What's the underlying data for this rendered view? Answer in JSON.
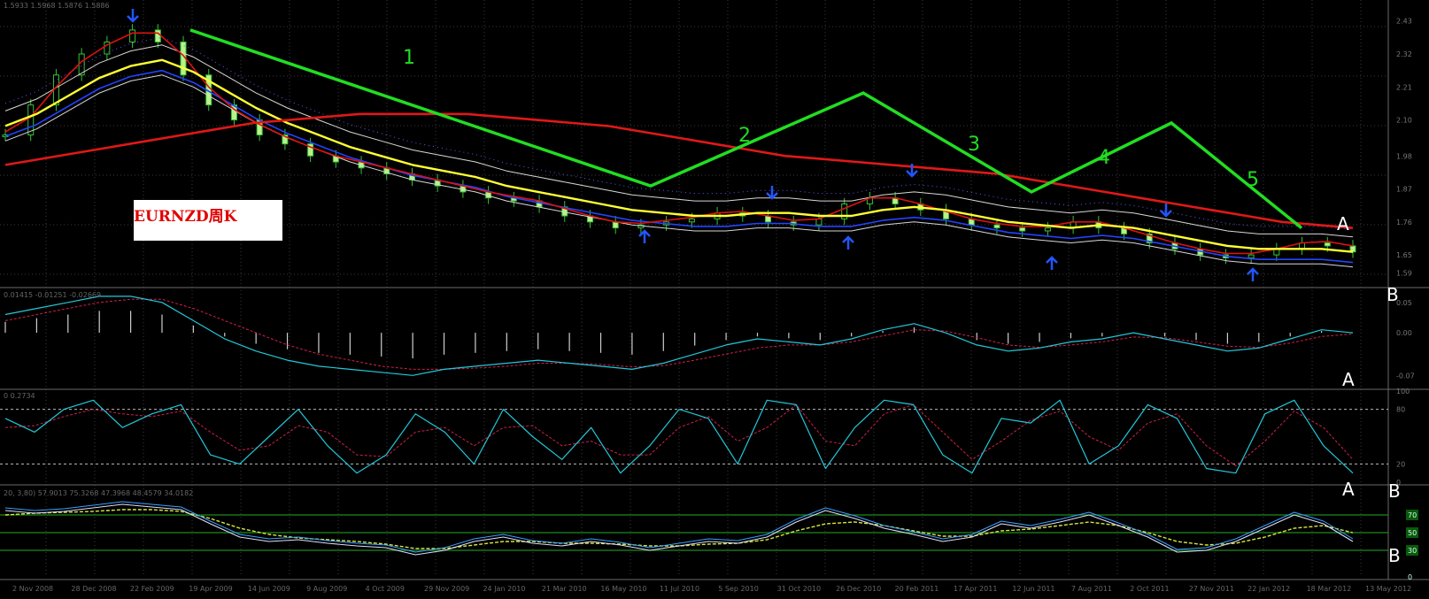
{
  "chart_data": [
    {
      "type": "line",
      "panel": "price",
      "title": "EURNZD周K",
      "header": "1.5933 1.5968 1.5876 1.5886",
      "wave_labels": [
        "1",
        "2",
        "3",
        "4",
        "5"
      ],
      "marks": [
        "A",
        "B"
      ],
      "wave_path": {
        "x": [
          "14 Jan 2009",
          "9 Aug 2010",
          "9 Feb 2011",
          "9 Aug 2011",
          "9 Feb 2012",
          "9 Aug 2012"
        ],
        "y": [
          2.4,
          1.88,
          2.19,
          1.86,
          2.09,
          1.74
        ]
      },
      "x_ticks": [
        "2 Nov 2008",
        "28 Dec 2008",
        "22 Feb 2009",
        "19 Apr 2009",
        "14 Jun 2009",
        "9 Aug 2009",
        "4 Oct 2009",
        "29 Nov 2009",
        "24 Jan 2010",
        "21 Mar 2010",
        "16 May 2010",
        "11 Jul 2010",
        "5 Sep 2010",
        "31 Oct 2010",
        "26 Dec 2010",
        "20 Feb 2011",
        "17 Apr 2011",
        "12 Jun 2011",
        "7 Aug 2011",
        "2 Oct 2011",
        "27 Nov 2011",
        "22 Jan 2012",
        "18 Mar 2012",
        "13 May 2012"
      ],
      "y_ticks": [
        2.43,
        2.32,
        2.21,
        2.1,
        1.98,
        1.87,
        1.76,
        1.65,
        1.59
      ],
      "ylim": [
        1.55,
        2.5
      ],
      "series": [
        {
          "name": "price",
          "values": [
            2.05,
            2.15,
            2.25,
            2.32,
            2.36,
            2.4,
            2.36,
            2.25,
            2.15,
            2.1,
            2.05,
            2.02,
            1.98,
            1.96,
            1.94,
            1.92,
            1.9,
            1.88,
            1.86,
            1.84,
            1.83,
            1.81,
            1.78,
            1.76,
            1.74,
            1.75,
            1.76,
            1.77,
            1.79,
            1.78,
            1.76,
            1.75,
            1.77,
            1.82,
            1.84,
            1.82,
            1.8,
            1.77,
            1.75,
            1.74,
            1.73,
            1.74,
            1.76,
            1.74,
            1.72,
            1.69,
            1.67,
            1.65,
            1.64,
            1.65,
            1.67,
            1.69,
            1.68,
            1.66
          ]
        },
        {
          "name": "ma-long",
          "values": [
            1.95,
            1.97,
            1.99,
            2.01,
            2.03,
            2.05,
            2.07,
            2.09,
            2.1,
            2.11,
            2.12,
            2.12,
            2.12,
            2.12,
            2.11,
            2.1,
            2.09,
            2.08,
            2.06,
            2.04,
            2.02,
            2.0,
            1.98,
            1.97,
            1.96,
            1.95,
            1.94,
            1.93,
            1.92,
            1.9,
            1.88,
            1.86,
            1.84,
            1.82,
            1.8,
            1.78,
            1.76,
            1.75,
            1.74
          ]
        },
        {
          "name": "ma-mid",
          "values": [
            2.08,
            2.12,
            2.18,
            2.24,
            2.28,
            2.3,
            2.26,
            2.2,
            2.14,
            2.09,
            2.05,
            2.01,
            1.98,
            1.95,
            1.93,
            1.91,
            1.88,
            1.86,
            1.84,
            1.82,
            1.8,
            1.79,
            1.78,
            1.78,
            1.79,
            1.79,
            1.78,
            1.78,
            1.8,
            1.81,
            1.8,
            1.78,
            1.76,
            1.75,
            1.74,
            1.75,
            1.74,
            1.72,
            1.7,
            1.68,
            1.67,
            1.67,
            1.67,
            1.66
          ]
        }
      ]
    },
    {
      "type": "line",
      "panel": "macd",
      "header": "0.01415 -0.01251 -0.02669",
      "y_ticks": [
        0.05,
        0.0,
        -0.07
      ],
      "ylim": [
        -0.09,
        0.07
      ],
      "series": [
        {
          "name": "macd",
          "values": [
            0.03,
            0.04,
            0.05,
            0.06,
            0.06,
            0.05,
            0.02,
            -0.01,
            -0.03,
            -0.045,
            -0.055,
            -0.06,
            -0.065,
            -0.07,
            -0.06,
            -0.055,
            -0.05,
            -0.045,
            -0.05,
            -0.055,
            -0.06,
            -0.05,
            -0.035,
            -0.02,
            -0.01,
            -0.015,
            -0.02,
            -0.01,
            0.005,
            0.015,
            0.0,
            -0.02,
            -0.03,
            -0.025,
            -0.015,
            -0.01,
            0.0,
            -0.01,
            -0.02,
            -0.03,
            -0.025,
            -0.01,
            0.005,
            0.0
          ]
        },
        {
          "name": "signal",
          "values": [
            0.02,
            0.03,
            0.04,
            0.05,
            0.055,
            0.055,
            0.04,
            0.02,
            0.0,
            -0.02,
            -0.035,
            -0.045,
            -0.055,
            -0.06,
            -0.06,
            -0.058,
            -0.055,
            -0.05,
            -0.05,
            -0.052,
            -0.056,
            -0.054,
            -0.045,
            -0.035,
            -0.025,
            -0.02,
            -0.02,
            -0.015,
            -0.005,
            0.005,
            0.003,
            -0.008,
            -0.02,
            -0.024,
            -0.02,
            -0.015,
            -0.007,
            -0.008,
            -0.015,
            -0.022,
            -0.024,
            -0.017,
            -0.006,
            -0.002
          ]
        }
      ]
    },
    {
      "type": "line",
      "panel": "stochastic",
      "header": "0 0.2734",
      "y_ticks": [
        100,
        80,
        20,
        0
      ],
      "ylim": [
        0,
        100
      ],
      "series": [
        {
          "name": "%K",
          "values": [
            70,
            55,
            80,
            90,
            60,
            75,
            85,
            30,
            20,
            50,
            80,
            40,
            10,
            30,
            75,
            55,
            20,
            80,
            50,
            25,
            60,
            10,
            40,
            80,
            70,
            20,
            90,
            85,
            15,
            60,
            90,
            85,
            30,
            10,
            70,
            65,
            90,
            20,
            40,
            85,
            70,
            15,
            10,
            75,
            90,
            40,
            10
          ]
        },
        {
          "name": "%D",
          "values": [
            60,
            62,
            72,
            80,
            75,
            72,
            78,
            55,
            35,
            40,
            62,
            55,
            30,
            28,
            55,
            60,
            40,
            60,
            62,
            40,
            45,
            30,
            30,
            60,
            72,
            45,
            60,
            85,
            45,
            40,
            75,
            85,
            55,
            25,
            45,
            68,
            78,
            50,
            35,
            65,
            75,
            40,
            18,
            45,
            78,
            60,
            25
          ]
        }
      ]
    },
    {
      "type": "line",
      "panel": "rsi",
      "header": "20, 3,80) 57.9013 75.3268 47.3968 48.4579 34.0182",
      "y_ticks": [
        70,
        50,
        30,
        0
      ],
      "ylim": [
        0,
        100
      ],
      "series": [
        {
          "name": "fast",
          "values": [
            75,
            72,
            74,
            78,
            82,
            79,
            76,
            60,
            45,
            40,
            42,
            38,
            35,
            33,
            25,
            30,
            40,
            45,
            38,
            35,
            40,
            36,
            30,
            35,
            40,
            38,
            45,
            62,
            75,
            66,
            55,
            48,
            40,
            45,
            60,
            55,
            62,
            70,
            58,
            45,
            28,
            30,
            40,
            55,
            70,
            60,
            40
          ]
        },
        {
          "name": "slow",
          "values": [
            70,
            72,
            73,
            74,
            76,
            76,
            74,
            66,
            55,
            48,
            44,
            42,
            40,
            37,
            32,
            32,
            36,
            40,
            40,
            38,
            38,
            37,
            35,
            35,
            37,
            38,
            42,
            52,
            60,
            62,
            58,
            52,
            46,
            46,
            52,
            54,
            58,
            62,
            58,
            50,
            40,
            36,
            38,
            45,
            55,
            58,
            50
          ]
        }
      ]
    }
  ]
}
